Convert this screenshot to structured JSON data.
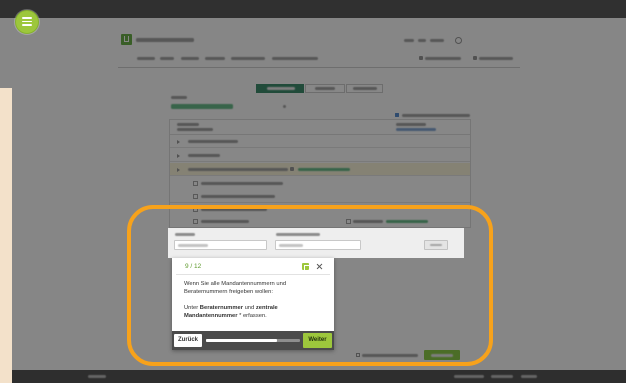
{
  "tour_popup": {
    "step": "9 / 12",
    "intro": "Wenn Sie alle Mandantennummern und Beraternummern freigeben wollen:",
    "instruction": {
      "prefix": "Unter ",
      "field_1": "Beraternummer",
      "joiner": " und ",
      "field_2": "zentrale Mandantennummer",
      "suffix": " * erfassen."
    },
    "back_label": "Zurück",
    "next_label": "Weiter",
    "progress": 0.75
  },
  "icons": {
    "tour_menu": "menu-icon",
    "popup_image": "image-icon",
    "popup_close": "close-icon",
    "app_logo": "logo-icon",
    "header_user": "user-icon"
  },
  "colors": {
    "accent": "#9dc73c",
    "accent_text": "#5f9a2e",
    "highlight_ring": "#f7a21b",
    "popup_footer": "#4b4b4b",
    "overlay": "rgba(0,0,0,0.47)",
    "side_panel": "#f3e1ca"
  }
}
